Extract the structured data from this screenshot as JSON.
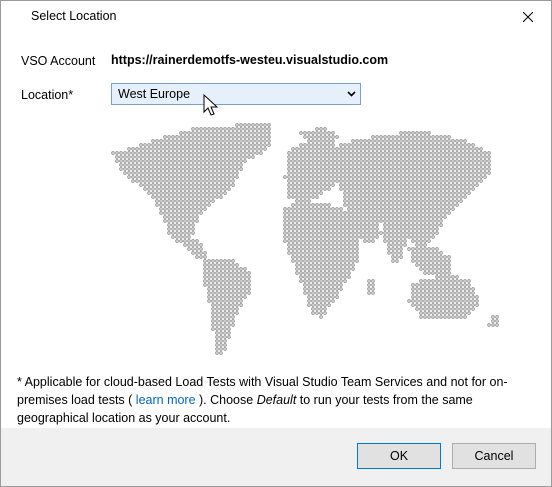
{
  "window": {
    "title": "Select Location",
    "close_icon": "close-icon"
  },
  "form": {
    "vso_label": "VSO Account",
    "vso_value": "https://rainerdemotfs-westeu.visualstudio.com",
    "location_label": "Location*",
    "location_value": "West Europe"
  },
  "map": {
    "description_icon": "world-dot-map"
  },
  "note": {
    "prefix": "* Applicable for cloud-based Load Tests with Visual Studio Team Services and not for on-premises load tests ( ",
    "link": "learn more",
    "middle": " ). Choose ",
    "emphasis": "Default",
    "suffix": " to run your tests from the same geographical location as your account."
  },
  "buttons": {
    "ok": "OK",
    "cancel": "Cancel"
  },
  "colors": {
    "dot": "#808080",
    "link": "#0066cc",
    "focus_border": "#0078d7",
    "select_bg": "#e6f0fb"
  }
}
